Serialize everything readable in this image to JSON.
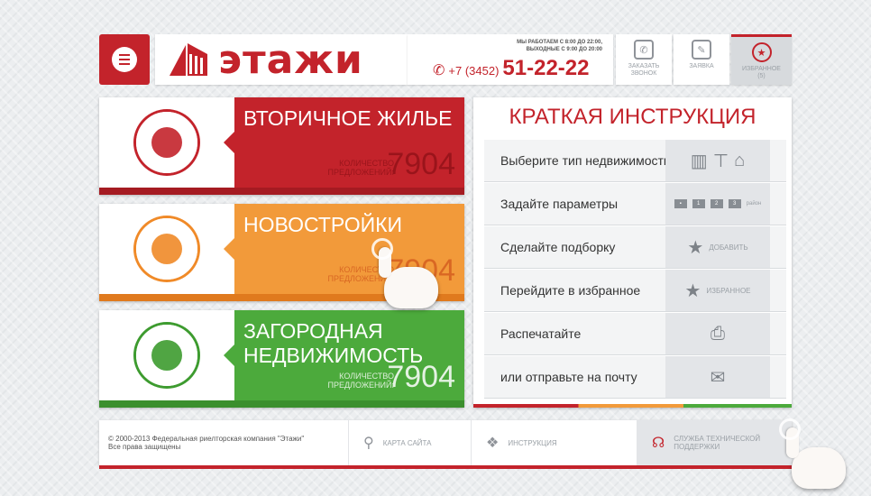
{
  "header": {
    "brand": "этажи",
    "hours_line1": "МЫ РАБОТАЕМ С 8:00 ДО 22:00,",
    "hours_line2": "ВЫХОДНЫЕ С 9:00 ДО 20:00",
    "phone_prefix": "+7 (3452)",
    "phone_number": "51-22-22",
    "call_button": "ЗАКАЗАТЬ\nЗВОНОК",
    "request_button": "ЗАЯВКА",
    "favorites_button": "ИЗБРАННОЕ\n(5)"
  },
  "tiles": [
    {
      "title": "ВТОРИЧНОЕ ЖИЛЬЕ",
      "count_label": "КОЛИЧЕСТВО\nПРЕДЛОЖЕНИЙ:",
      "count": "7904",
      "color": "#c3232b"
    },
    {
      "title": "НОВОСТРОЙКИ",
      "count_label": "КОЛИЧЕСТВО\nПРЕДЛОЖЕНИЙ:",
      "count": "7904",
      "color": "#f29a3a"
    },
    {
      "title": "ЗАГОРОДНАЯ\nНЕДВИЖИМОСТЬ",
      "count_label": "КОЛИЧЕСТВО\nПРЕДЛОЖЕНИЙ:",
      "count": "7904",
      "color": "#4caa3c"
    }
  ],
  "instruction": {
    "title": "КРАТКАЯ ИНСТРУКЦИЯ",
    "steps": [
      {
        "text": "Выберите тип недвижимости"
      },
      {
        "text": "Задайте параметры",
        "icon_text": "район"
      },
      {
        "text": "Сделайте подборку",
        "icon_text": "ДОБАВИТЬ"
      },
      {
        "text": "Перейдите в избранное",
        "icon_text": "ИЗБРАННОЕ"
      },
      {
        "text": "Распечатайте"
      },
      {
        "text": "или отправьте на почту"
      }
    ]
  },
  "footer": {
    "copyright": "© 2000-2013 Федеральная риелторская компания \"Этажи\"\nВсе права защищены",
    "site_map": "КАРТА САЙТА",
    "instructions": "ИНСТРУКЦИЯ",
    "support": "СЛУЖБА ТЕХНИЧЕСКОЙ\nПОДДЕРЖКИ"
  },
  "icons": {
    "menu": "menu-icon",
    "phone": "phone-icon",
    "call": "chat-icon",
    "request": "edit-icon",
    "favorites": "star-icon",
    "site_map": "sitemap-icon",
    "instructions": "dropbox-icon",
    "support": "headset-icon"
  },
  "colors": {
    "accent": "#c3232b",
    "orange": "#f29a3a",
    "green": "#4caa3c"
  }
}
